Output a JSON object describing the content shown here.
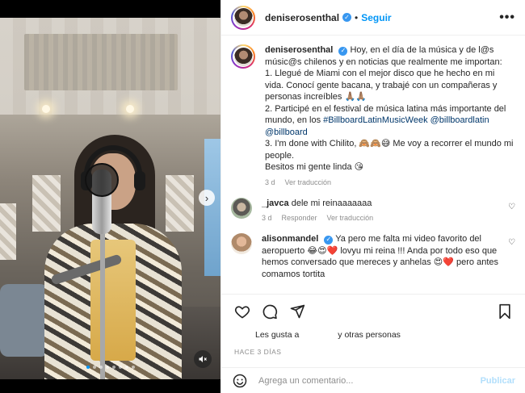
{
  "post": {
    "username": "deniserosenthal",
    "follow_label": "Seguir",
    "separator": "•",
    "more_label": "•••"
  },
  "caption": {
    "username": "deniserosenthal",
    "line1": "Hoy, en el día de la música y de l@s músic@s chilenos y en noticias que realmente me importan:",
    "line2": "1. Llegué de Miami con el mejor disco que he hecho en mi vida. Conocí gente bacana, y trabajé con un compañeras y personas increíbles 🙏🏽🙏🏽",
    "line3_prefix": "2. Participé en el festival de música latina más importante del mundo, en los ",
    "hashtag": "#BillboardLatinMusicWeek",
    "mention1": "@billboardlatin",
    "mention2": "@billboard",
    "line4": "3. I'm done with Chilito, 🙈🙈😅 Me voy a recorrer el mundo mi people.",
    "line5": "Besitos mi gente linda 😘",
    "time": "3 d",
    "translate": "Ver traducción"
  },
  "comments": [
    {
      "username": "_javca",
      "text": "dele mi reinaaaaaaa",
      "time": "3 d",
      "reply": "Responder",
      "translate": "Ver traducción"
    },
    {
      "username": "alisonmandel",
      "text": "Ya pero me falta mi video favorito del aeropuerto 😂😍❤️ lovyu mi reina !!! Anda por todo eso que hemos conversado que mereces y anhelas 😍❤️ pero antes comamos tortita"
    }
  ],
  "actions": {
    "likes_prefix": "Les gusta a",
    "likes_suffix": "y otras personas",
    "date": "HACE 3 DÍAS"
  },
  "composer": {
    "placeholder": "Agrega un comentario...",
    "publish": "Publicar"
  },
  "colors": {
    "accent": "#0095f6",
    "verified": "#3897f0",
    "muted": "#8e8e8e"
  }
}
